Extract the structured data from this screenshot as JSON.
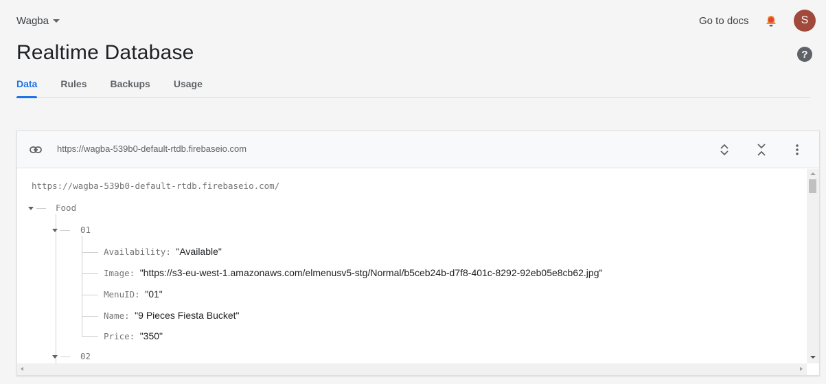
{
  "header": {
    "project_name": "Wagba",
    "docs_link": "Go to docs",
    "avatar_letter": "S",
    "page_title": "Realtime Database"
  },
  "tabs": [
    {
      "label": "Data",
      "active": true
    },
    {
      "label": "Rules",
      "active": false
    },
    {
      "label": "Backups",
      "active": false
    },
    {
      "label": "Usage",
      "active": false
    }
  ],
  "database": {
    "url": "https://wagba-539b0-default-rtdb.firebaseio.com",
    "root_url": "https://wagba-539b0-default-rtdb.firebaseio.com/",
    "tree": {
      "root_key": "Food",
      "child_1_key": "01",
      "fields": [
        {
          "key": "Availability",
          "value": "\"Available\""
        },
        {
          "key": "Image",
          "value": "\"https://s3-eu-west-1.amazonaws.com/elmenusv5-stg/Normal/b5ceb24b-d7f8-401c-8292-92eb05e8cb62.jpg\""
        },
        {
          "key": "MenuID",
          "value": "\"01\""
        },
        {
          "key": "Name",
          "value": "\"9 Pieces Fiesta Bucket\""
        },
        {
          "key": "Price",
          "value": "\"350\""
        }
      ],
      "child_2_key": "02"
    }
  },
  "colors": {
    "accent": "#1a73e8",
    "avatar_bg": "#a1493b",
    "bell_accent": "#e94235"
  }
}
